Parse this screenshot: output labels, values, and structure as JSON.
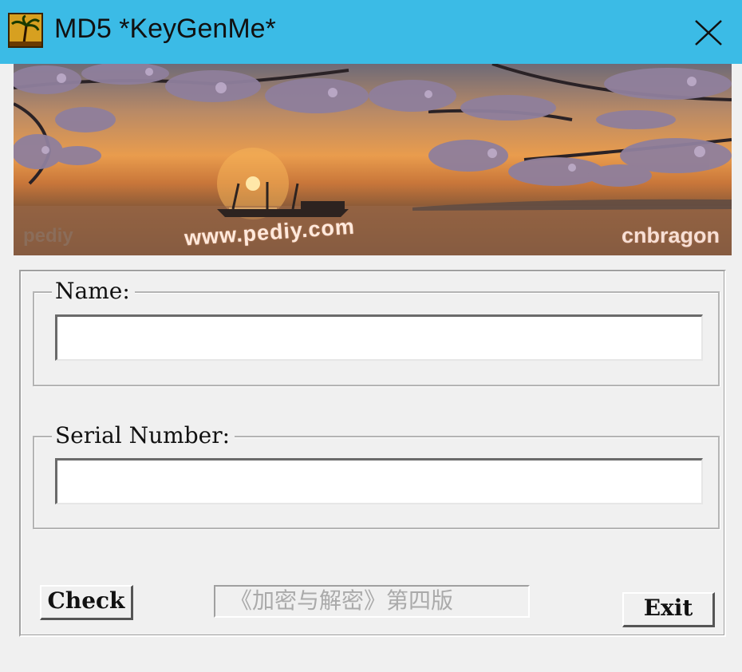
{
  "window": {
    "title": "MD5 *KeyGenMe*",
    "title_bar_color": "#3bbbe6",
    "icon": "app-palm-tree-icon",
    "close_icon": "close-icon"
  },
  "banner": {
    "watermark_left": "pediy",
    "watermark_center": "www.pediy.com",
    "watermark_right": "cnbragon"
  },
  "form": {
    "name_label": "Name:",
    "name_value": "",
    "serial_label": "Serial Number:",
    "serial_value": ""
  },
  "buttons": {
    "check_label": "Check",
    "exit_label": "Exit"
  },
  "footer": {
    "book_label": "《加密与解密》第四版"
  }
}
